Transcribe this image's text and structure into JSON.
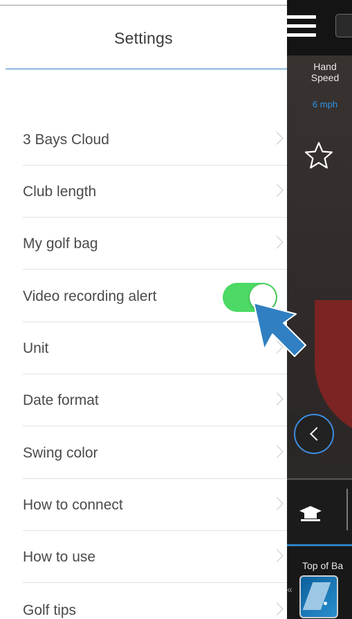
{
  "settings": {
    "title": "Settings",
    "items": [
      {
        "label": "3 Bays Cloud",
        "control": "chevron"
      },
      {
        "label": "Club length",
        "control": "chevron"
      },
      {
        "label": "My golf bag",
        "control": "chevron"
      },
      {
        "label": "Video recording alert",
        "control": "toggle",
        "toggle_on": true
      },
      {
        "label": "Unit",
        "control": "chevron"
      },
      {
        "label": "Date format",
        "control": "chevron"
      },
      {
        "label": "Swing color",
        "control": "chevron"
      },
      {
        "label": "How to connect",
        "control": "chevron"
      },
      {
        "label": "How to use",
        "control": "chevron"
      },
      {
        "label": "Golf tips",
        "control": "chevron"
      }
    ]
  },
  "app": {
    "hand_speed_label_1": "Hand",
    "hand_speed_label_2": "Speed",
    "hand_speed_value": "6 mph",
    "bottom_label": "Top of Ba",
    "collapse_glyph": "«"
  },
  "colors": {
    "accent_blue": "#2f7fc2",
    "toggle_green": "#4cd964",
    "arrow_blue": "#2f7fc2",
    "club_red": "#7b2423",
    "speed_blue": "#2d95e8"
  },
  "icons": [
    "menu-icon",
    "star-icon",
    "back-chevron-icon",
    "chevron-right-icon",
    "cap-icon",
    "swing-thumbnail-icon"
  ]
}
